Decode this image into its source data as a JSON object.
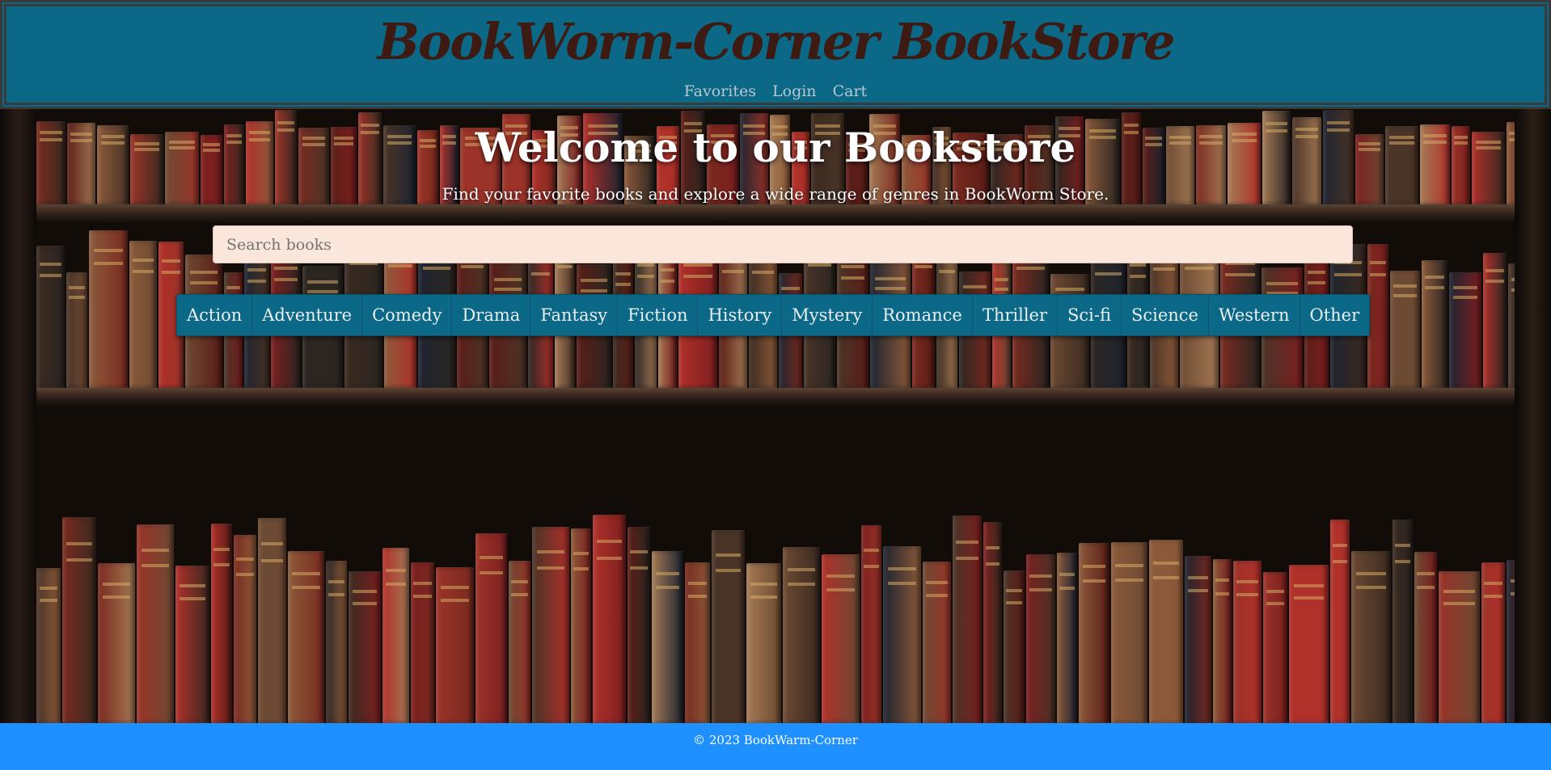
{
  "header": {
    "brand": "BookWorm-Corner BookStore",
    "nav": {
      "favorites": "Favorites",
      "login": "Login",
      "cart": "Cart"
    }
  },
  "hero": {
    "title": "Welcome to our Bookstore",
    "subtitle": "Find your favorite books and explore a wide range of genres in BookWorm Store."
  },
  "search": {
    "placeholder": "Search books",
    "value": ""
  },
  "genres": [
    "Action",
    "Adventure",
    "Comedy",
    "Drama",
    "Fantasy",
    "Fiction",
    "History",
    "Mystery",
    "Romance",
    "Thriller",
    "Sci-fi",
    "Science",
    "Western",
    "Other"
  ],
  "footer": {
    "copyright": "© 2023 BookWarm-Corner"
  },
  "colors": {
    "header_bg": "#0b6886",
    "brand_text": "#3d1a12",
    "search_bg": "#fae6da",
    "genre_bar": "#0b6886",
    "footer_bg": "#1e90ff"
  }
}
